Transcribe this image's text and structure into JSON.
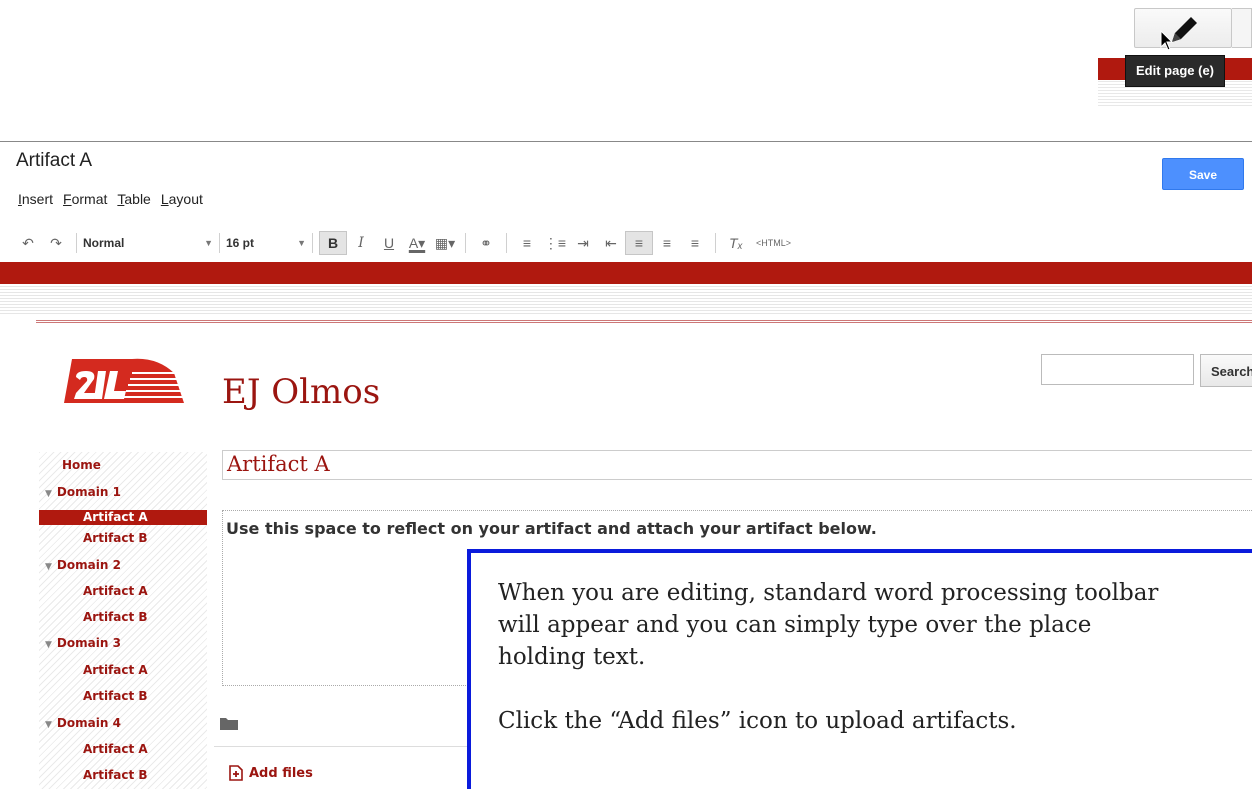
{
  "tooltip": {
    "text": "Edit page (e)"
  },
  "editor": {
    "title": "Artifact A",
    "save_label": "Save",
    "menu": [
      {
        "key": "I",
        "rest": "nsert"
      },
      {
        "key": "F",
        "rest": "ormat"
      },
      {
        "key": "T",
        "rest": "able"
      },
      {
        "key": "L",
        "rest": "ayout"
      }
    ],
    "toolbar": {
      "style": "Normal",
      "size": "16 pt",
      "html": "<HTML>"
    }
  },
  "site": {
    "title": "EJ Olmos",
    "search_label": "Search"
  },
  "sidebar": {
    "items": [
      {
        "label": "Home",
        "level": 0
      },
      {
        "label": "Domain 1",
        "level": 1
      },
      {
        "label": "Artifact A",
        "level": 2,
        "active": true
      },
      {
        "label": "Artifact B",
        "level": 2
      },
      {
        "label": "Domain 2",
        "level": 1
      },
      {
        "label": "Artifact A",
        "level": 2
      },
      {
        "label": "Artifact B",
        "level": 2
      },
      {
        "label": "Domain 3",
        "level": 1
      },
      {
        "label": "Artifact A",
        "level": 2
      },
      {
        "label": "Artifact B",
        "level": 2
      },
      {
        "label": "Domain 4",
        "level": 1
      },
      {
        "label": "Artifact A",
        "level": 2
      },
      {
        "label": "Artifact B",
        "level": 2
      }
    ]
  },
  "content": {
    "heading": "Artifact A",
    "body": "Use this space to reflect on your artifact and attach your artifact below.",
    "add_files": "Add files"
  },
  "callout": {
    "line1": "When you are editing, standard word processing toolbar",
    "line2": "will appear and you can simply type over the place",
    "line3": "holding text.",
    "line4": "Click the “Add files” icon to upload artifacts."
  },
  "colors": {
    "brand_red": "#b0190f",
    "save_blue": "#4d90fe",
    "callout_border": "#0a1bdc"
  }
}
